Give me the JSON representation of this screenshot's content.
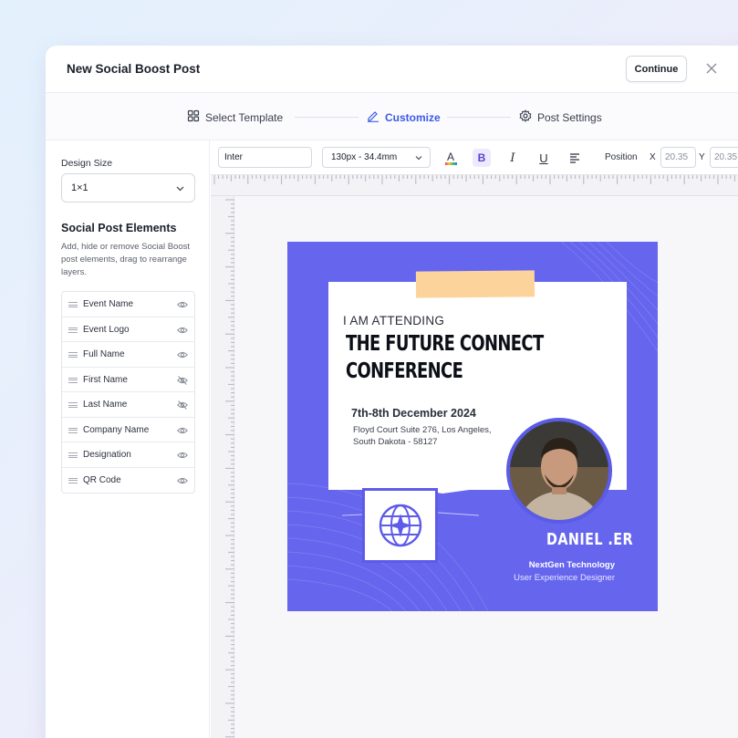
{
  "modal": {
    "title": "New Social Boost Post",
    "continue_label": "Continue"
  },
  "steps": [
    {
      "label": "Select Template",
      "icon": "grid-icon",
      "active": false
    },
    {
      "label": "Customize",
      "icon": "pen-icon",
      "active": true
    },
    {
      "label": "Post Settings",
      "icon": "gear-icon",
      "active": false
    }
  ],
  "sidebar": {
    "design_size_label": "Design Size",
    "design_size_value": "1×1",
    "heading": "Social Post Elements",
    "description": "Add, hide or remove Social Boost post elements, drag to rearrange layers.",
    "elements": [
      {
        "label": "Event Name",
        "visible": true
      },
      {
        "label": "Event Logo",
        "visible": true
      },
      {
        "label": "Full Name",
        "visible": true
      },
      {
        "label": "First Name",
        "visible": false
      },
      {
        "label": "Last Name",
        "visible": false
      },
      {
        "label": "Company Name",
        "visible": true
      },
      {
        "label": "Designation",
        "visible": true
      },
      {
        "label": "QR Code",
        "visible": true
      }
    ]
  },
  "toolbar": {
    "font": "Inter",
    "size": "130px - 34.4mm",
    "text_color_glyph": "A",
    "bold_glyph": "B",
    "italic_glyph": "I",
    "underline_glyph": "U",
    "position_label": "Position",
    "x_label": "X",
    "x_value": "20.35",
    "y_label": "Y",
    "y_value": "20.35"
  },
  "post": {
    "attending": "I AM ATTENDING",
    "title_line1": "THE FUTURE CONNECT",
    "title_line2": "CONFERENCE",
    "date": "7th-8th December 2024",
    "address_line1": "Floyd Court Suite 276, Los Angeles,",
    "address_line2": "South Dakota - 58127",
    "name": "DANIEL .ER",
    "company": "NextGen Technology",
    "designation": "User Experience Designer",
    "colors": {
      "background": "#6565ee",
      "tape": "#fcd49b",
      "accent": "#3a5ae8"
    }
  }
}
